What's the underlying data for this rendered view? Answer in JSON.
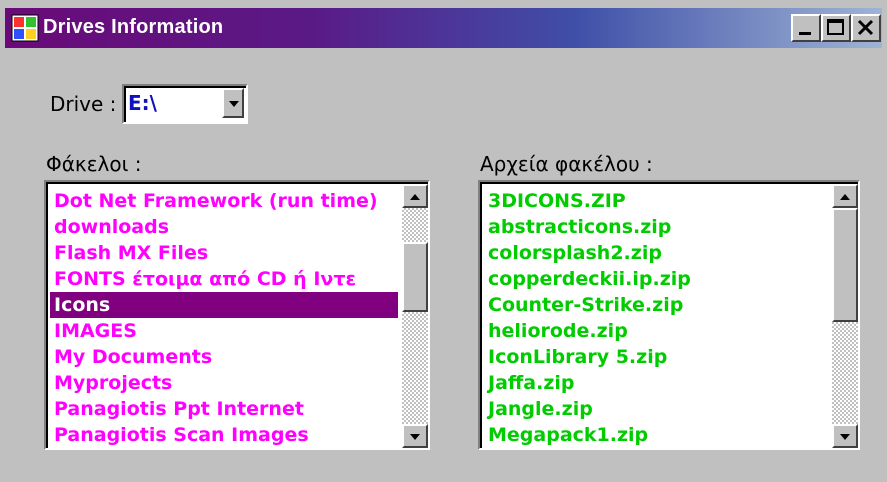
{
  "window": {
    "title": "Drives Information",
    "title_gradient": [
      "#6a0a78",
      "#3f4fa8",
      "#9fb4d4"
    ],
    "buttons": {
      "minimize": "minimize-icon",
      "maximize": "maximize-icon",
      "close": "close-icon"
    }
  },
  "drive": {
    "label": "Drive :",
    "selected": "E:\\",
    "value_color": "#1010c0"
  },
  "folders": {
    "label": "Φάκελοι :",
    "item_color": "#ff00ff",
    "selected_bg": "#800080",
    "items": [
      "Dot Net Framework (run time)",
      "downloads",
      "Flash MX Files",
      "FONTS έτοιμα από CD ή Ιντε",
      "Icons",
      "IMAGES",
      "My Documents",
      "Myprojects",
      "Panagiotis Ppt Internet",
      "Panagiotis Scan Images"
    ],
    "selected_item": "Icons"
  },
  "files": {
    "label": "Αρχεία φακέλου :",
    "item_color": "#00cc00",
    "items": [
      "3DICONS.ZIP",
      "abstracticons.zip",
      "colorsplash2.zip",
      "copperdeckii.ip.zip",
      "Counter-Strike.zip",
      "heliorode.zip",
      "IconLibrary 5.zip",
      "Jaffa.zip",
      "Jangle.zip",
      "Megapack1.zip"
    ]
  }
}
